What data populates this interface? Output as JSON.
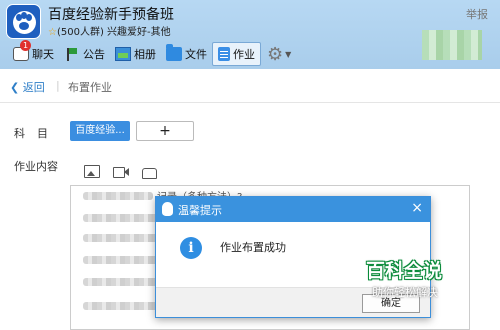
{
  "window": {
    "title": "百度经验新手预备班",
    "subtitle": "(500人群) 兴趣爱好-其他",
    "report": "举报"
  },
  "tabs": [
    {
      "label": "聊天",
      "icon": "chat-icon",
      "badge": "1"
    },
    {
      "label": "公告",
      "icon": "flag-icon"
    },
    {
      "label": "相册",
      "icon": "photo-icon"
    },
    {
      "label": "文件",
      "icon": "folder-icon"
    },
    {
      "label": "作业",
      "icon": "homework-icon",
      "active": true
    }
  ],
  "nav": {
    "back": "返回",
    "separator": "|",
    "crumb": "布置作业"
  },
  "form": {
    "subject_label": "科目",
    "subject_chip": "百度经验...",
    "add_label": "+",
    "content_label": "作业内容",
    "content_visible_text": "记录（多种方法）?"
  },
  "dialog": {
    "title": "温馨提示",
    "close": "×",
    "info_glyph": "i",
    "message": "作业布置成功",
    "ok_label": "确定"
  },
  "watermark": {
    "main": "百科全说",
    "sub": "助你轻松解决"
  },
  "colors": {
    "accent": "#3a92de",
    "header_bg": "#b7d8f3",
    "chip_bg": "#3b8ee0",
    "badge": "#e0322e"
  }
}
